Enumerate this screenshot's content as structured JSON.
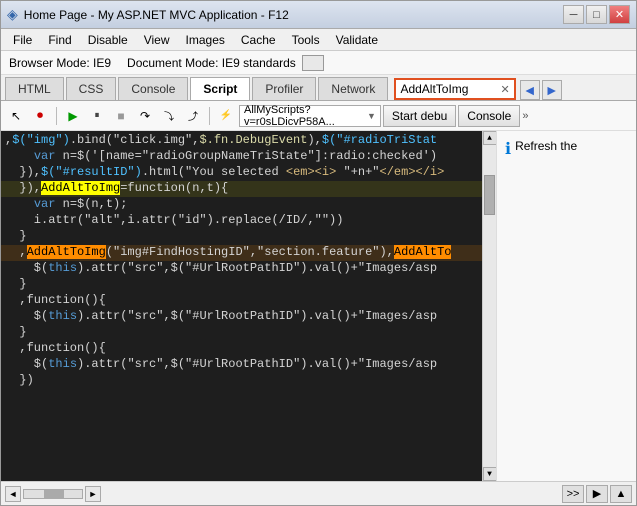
{
  "window": {
    "title": "Home Page - My ASP.NET MVC Application - F12",
    "min_btn": "─",
    "max_btn": "□",
    "close_btn": "✕"
  },
  "menubar": {
    "items": [
      "File",
      "Find",
      "Disable",
      "View",
      "Images",
      "Cache",
      "Tools",
      "Validate"
    ]
  },
  "browser_mode": {
    "label1": "Browser Mode: IE9",
    "label2": "Document Mode: IE9 standards"
  },
  "tabs": {
    "items": [
      "HTML",
      "CSS",
      "Console",
      "Script",
      "Profiler",
      "Network"
    ],
    "active": "Script",
    "search_value": "AddAltToImg"
  },
  "toolbar": {
    "dropdown_value": "AllMyScripts?v=r0sLDicvP58A...",
    "start_debug": "Start debu",
    "console": "Console"
  },
  "right_panel": {
    "refresh_text": "Refresh the"
  },
  "code": {
    "lines": [
      {
        "text": "  ,$(\"img\").bind(\"click.img\",$.fn.DebugEvent),$(\"#radioTriStat",
        "parts": [
          {
            "t": "  ,",
            "c": "c-default"
          },
          {
            "t": "$(\"img\")",
            "c": "c-jquery"
          },
          {
            "t": ".bind(\"click.img\",",
            "c": "c-default"
          },
          {
            "t": "$.fn.DebugEvent",
            "c": "c-func"
          },
          {
            "t": "),$(\"#radioTriStat",
            "c": "c-default"
          }
        ]
      },
      {
        "text": "    var n=$('[name=\"radioGroupNameTriState\"]:radio:checked')",
        "parts": [
          {
            "t": "    ",
            "c": "c-default"
          },
          {
            "t": "var",
            "c": "c-keyword"
          },
          {
            "t": " n=$('[name=\"radioGroupNameTriState\"]:radio:checked')",
            "c": "c-default"
          }
        ]
      },
      {
        "text": "  }),$(\"#resultID\").html(\"You selected <em><i> \"+n+\"</em></i>",
        "parts": [
          {
            "t": "  }),$(\"#resultID\").html(\"You selected ",
            "c": "c-default"
          },
          {
            "t": "<em><i>",
            "c": "c-selector"
          },
          {
            "t": " \"+n+\"",
            "c": "c-default"
          },
          {
            "t": "</em></i>",
            "c": "c-selector"
          }
        ]
      },
      {
        "text": "  }),AddAltToImg=function(n,t){",
        "hl_start": "AddAltToImg",
        "parts": [
          {
            "t": "  }),",
            "c": "c-default"
          },
          {
            "t": "AddAltToImg",
            "c": "c-highlight-yellow"
          },
          {
            "t": "=function(n,t){",
            "c": "c-default"
          }
        ]
      },
      {
        "text": "    var n=$(n,t);",
        "parts": [
          {
            "t": "    ",
            "c": "c-default"
          },
          {
            "t": "var",
            "c": "c-keyword"
          },
          {
            "t": " n=$(n,t);",
            "c": "c-default"
          }
        ]
      },
      {
        "text": "    i.attr(\"alt\",i.attr(\"id\").replace(/ID/,\"\"))",
        "parts": [
          {
            "t": "    i.attr(\"alt\",i.attr(\"id\").replace(/ID/,\"\"))",
            "c": "c-default"
          }
        ]
      },
      {
        "text": "  }",
        "parts": [
          {
            "t": "  }",
            "c": "c-default"
          }
        ]
      },
      {
        "text": "  ,AddAltToImg(\"img#FindHostingID\",\"section.feature\"),AddAltTo",
        "hl": true,
        "parts": [
          {
            "t": "  ,",
            "c": "c-default"
          },
          {
            "t": "AddAltToImg",
            "c": "c-highlight-search"
          },
          {
            "t": "(\"img#FindHostingID\",\"section.feature\"),",
            "c": "c-default"
          },
          {
            "t": "AddAltTo",
            "c": "c-highlight-search"
          }
        ]
      },
      {
        "text": "    $(this).attr(\"src\",$(\"#UrlRootPathID\").val()+\"Images/asp",
        "parts": [
          {
            "t": "    $(",
            "c": "c-default"
          },
          {
            "t": "this",
            "c": "c-keyword"
          },
          {
            "t": ").attr(\"src\",$(\"#UrlRootPathID\").val()+\"Images/asp",
            "c": "c-default"
          }
        ]
      },
      {
        "text": "  }",
        "parts": [
          {
            "t": "  }",
            "c": "c-default"
          }
        ]
      },
      {
        "text": "  ,function(){",
        "parts": [
          {
            "t": "  ,function(){",
            "c": "c-default"
          }
        ]
      },
      {
        "text": "    $(this).attr(\"src\",$(\"#UrlRootPathID\").val()+\"Images/asp",
        "parts": [
          {
            "t": "    $(",
            "c": "c-default"
          },
          {
            "t": "this",
            "c": "c-keyword"
          },
          {
            "t": ").attr(\"src\",$(\"#UrlRootPathID\").val()+\"Images/asp",
            "c": "c-default"
          }
        ]
      },
      {
        "text": "  }",
        "parts": [
          {
            "t": "  }",
            "c": "c-default"
          }
        ]
      },
      {
        "text": "  ,function(){",
        "parts": [
          {
            "t": "  ,function(){",
            "c": "c-default"
          }
        ]
      },
      {
        "text": "    $(this).attr(\"src\",$(\"#UrlRootPathID\").val()+\"Images/asp",
        "parts": [
          {
            "t": "    $(",
            "c": "c-default"
          },
          {
            "t": "this",
            "c": "c-keyword"
          },
          {
            "t": ").attr(\"src\",$(\"#UrlRootPathID\").val()+\"Images/asp",
            "c": "c-default"
          }
        ]
      },
      {
        "text": "  })",
        "parts": [
          {
            "t": "  })",
            "c": "c-default"
          }
        ]
      }
    ]
  },
  "bottom": {
    "nav_prev": ">>",
    "nav_play": "▶",
    "nav_up": "▲"
  }
}
